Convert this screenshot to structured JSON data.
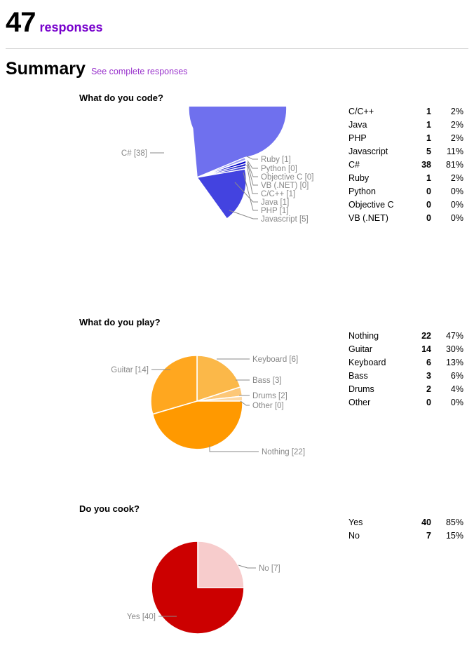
{
  "header": {
    "count": "47",
    "responses_label": "responses"
  },
  "summary": {
    "title": "Summary",
    "link_label": "See complete responses"
  },
  "questions": [
    {
      "title": "What do you code?",
      "chart_data": {
        "type": "pie",
        "title": "What do you code?",
        "categories": [
          "C/C++",
          "Java",
          "PHP",
          "Javascript",
          "C#",
          "Ruby",
          "Python",
          "Objective C",
          "VB (.NET)"
        ],
        "values": [
          1,
          1,
          1,
          5,
          38,
          1,
          0,
          0,
          0
        ],
        "percents": [
          "2%",
          "2%",
          "2%",
          "11%",
          "81%",
          "2%",
          "0%",
          "0%",
          "0%"
        ],
        "colors": [
          "#4343e0",
          "#3a3ad6",
          "#2222cc",
          "#0000cc",
          "#6f70ee",
          "#9a9bf2",
          "#8f90f0",
          "#8486ef",
          "#7a7cee"
        ],
        "total": 47,
        "legend_position": "right-table"
      },
      "slice_labels": [
        {
          "text": "C# [38]",
          "side": "left"
        },
        {
          "text": "Ruby [1]",
          "side": "right"
        },
        {
          "text": "Python [0]",
          "side": "right"
        },
        {
          "text": "Objective C [0]",
          "side": "right"
        },
        {
          "text": "VB (.NET) [0]",
          "side": "right"
        },
        {
          "text": "C/C++ [1]",
          "side": "right"
        },
        {
          "text": "Java [1]",
          "side": "right"
        },
        {
          "text": "PHP [1]",
          "side": "right"
        },
        {
          "text": "Javascript [5]",
          "side": "right"
        }
      ],
      "table": {
        "rows": [
          {
            "label": "C/C++",
            "count": "1",
            "pct": "2%"
          },
          {
            "label": "Java",
            "count": "1",
            "pct": "2%"
          },
          {
            "label": "PHP",
            "count": "1",
            "pct": "2%"
          },
          {
            "label": "Javascript",
            "count": "5",
            "pct": "11%"
          },
          {
            "label": "C#",
            "count": "38",
            "pct": "81%"
          },
          {
            "label": "Ruby",
            "count": "1",
            "pct": "2%"
          },
          {
            "label": "Python",
            "count": "0",
            "pct": "0%"
          },
          {
            "label": "Objective C",
            "count": "0",
            "pct": "0%"
          },
          {
            "label": "VB (.NET)",
            "count": "0",
            "pct": "0%"
          }
        ]
      }
    },
    {
      "title": "What do you play?",
      "chart_data": {
        "type": "pie",
        "title": "What do you play?",
        "categories": [
          "Nothing",
          "Guitar",
          "Keyboard",
          "Bass",
          "Drums",
          "Other"
        ],
        "values": [
          22,
          14,
          6,
          3,
          2,
          0
        ],
        "percents": [
          "47%",
          "30%",
          "13%",
          "6%",
          "4%",
          "0%"
        ],
        "colors": [
          "#ff9900",
          "#ffa71f",
          "#fbb849",
          "#fcc778",
          "#fdd9a6",
          "#fee6c4"
        ],
        "total": 47,
        "legend_position": "right-table"
      },
      "slice_labels": [
        {
          "text": "Guitar [14]",
          "side": "left"
        },
        {
          "text": "Keyboard [6]",
          "side": "right"
        },
        {
          "text": "Bass [3]",
          "side": "right"
        },
        {
          "text": "Drums [2]",
          "side": "right"
        },
        {
          "text": "Other [0]",
          "side": "right"
        },
        {
          "text": "Nothing [22]",
          "side": "bottom"
        }
      ],
      "table": {
        "rows": [
          {
            "label": "Nothing",
            "count": "22",
            "pct": "47%"
          },
          {
            "label": "Guitar",
            "count": "14",
            "pct": "30%"
          },
          {
            "label": "Keyboard",
            "count": "6",
            "pct": "13%"
          },
          {
            "label": "Bass",
            "count": "3",
            "pct": "6%"
          },
          {
            "label": "Drums",
            "count": "2",
            "pct": "4%"
          },
          {
            "label": "Other",
            "count": "0",
            "pct": "0%"
          }
        ]
      }
    },
    {
      "title": "Do you cook?",
      "chart_data": {
        "type": "pie",
        "title": "Do you cook?",
        "categories": [
          "Yes",
          "No"
        ],
        "values": [
          40,
          7
        ],
        "percents": [
          "85%",
          "15%"
        ],
        "colors": [
          "#cc0000",
          "#f7cccc"
        ],
        "total": 47,
        "legend_position": "right-table"
      },
      "slice_labels": [
        {
          "text": "Yes [40]",
          "side": "left"
        },
        {
          "text": "No [7]",
          "side": "right"
        }
      ],
      "table": {
        "rows": [
          {
            "label": "Yes",
            "count": "40",
            "pct": "85%"
          },
          {
            "label": "No",
            "count": "7",
            "pct": "15%"
          }
        ]
      }
    }
  ]
}
